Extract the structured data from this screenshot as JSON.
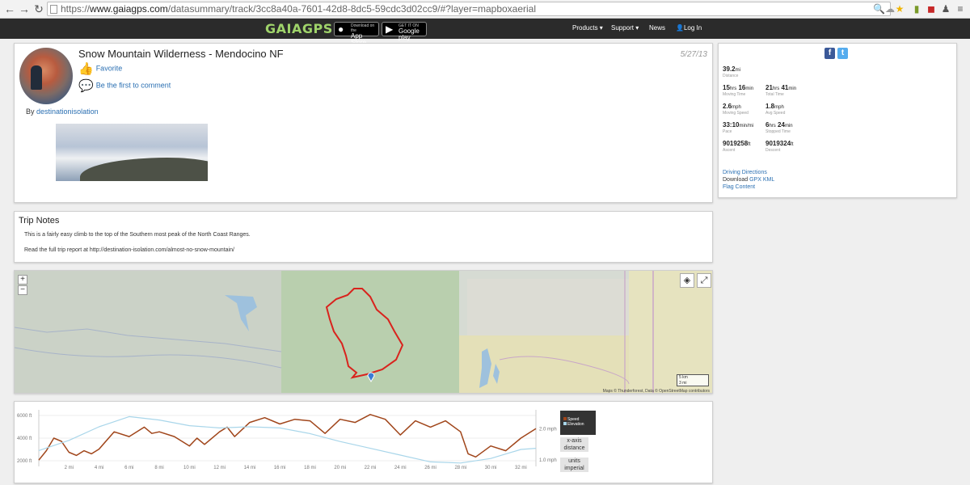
{
  "browser": {
    "url_prefix": "https://",
    "url_host": "www.gaiagps.com",
    "url_path": "/datasummary/track/3cc8a40a-7601-42d8-8dc5-59cdc3d02cc9/#?layer=mapboxaerial"
  },
  "header": {
    "logo": "GAIAGPS",
    "app_store": {
      "small": "Download on the",
      "label": "App Store"
    },
    "google_play": {
      "small": "GET IT ON",
      "label": "Google play"
    },
    "nav": [
      "Products ▾",
      "Support ▾",
      "News",
      "Log In"
    ]
  },
  "track": {
    "title": "Snow Mountain Wilderness - Mendocino NF",
    "date": "5/27/13",
    "favorite": "Favorite",
    "comment": "Be the first to comment",
    "by_prefix": "By",
    "author": "destinationisolation"
  },
  "stats": [
    {
      "value": "39.2",
      "unit": "mi",
      "label": "Distance"
    },
    {
      "value": "15",
      "unit": "hrs",
      "value2": "16",
      "unit2": "min",
      "label": "Moving Time"
    },
    {
      "value": "21",
      "unit": "hrs",
      "value2": "41",
      "unit2": "min",
      "label": "Total Time"
    },
    {
      "value": "2.6",
      "unit": "mph",
      "label": "Moving Speed"
    },
    {
      "value": "1.8",
      "unit": "mph",
      "label": "Avg Speed"
    },
    {
      "value": "33:10",
      "unit": "min/mi",
      "label": "Pace"
    },
    {
      "value": "6",
      "unit": "hrs",
      "value2": "24",
      "unit2": "min",
      "label": "Stopped Time"
    },
    {
      "value": "9019258",
      "unit": "ft",
      "label": "Ascent"
    },
    {
      "value": "9019324",
      "unit": "ft",
      "label": "Descent"
    }
  ],
  "links": {
    "driving": "Driving Directions",
    "download": "Download",
    "gpx": "GPX",
    "kml": "KML",
    "flag": "Flag Content"
  },
  "notes": {
    "title": "Trip Notes",
    "line1": "This is a fairly easy climb to the top of the Southern most peak of the North Coast Ranges.",
    "line2": "Read the full trip report at http://destination-isolation.com/almost-no-snow-mountain/"
  },
  "map": {
    "zoom_in": "+",
    "zoom_out": "−",
    "scale_km": "5 km",
    "scale_mi": "3 mi",
    "attribution": "Maps © Thunderforest, Data © OpenStreetMap contributors",
    "track_color": "#d9231d"
  },
  "chart": {
    "legend_speed": "Speed",
    "legend_elevation": "Elevation",
    "btn_x_axis_line1": "x-axis",
    "btn_x_axis_line2": "distance",
    "btn_units_line1": "units",
    "btn_units_line2": "imperial",
    "speed_color": "#a0451a",
    "elevation_color": "#a9d6ea"
  },
  "chart_data": {
    "type": "line",
    "xlabel": "",
    "ylabel": "",
    "x_ticks": [
      "2 mi",
      "4 mi",
      "6 mi",
      "8 mi",
      "10 mi",
      "12 mi",
      "14 mi",
      "16 mi",
      "18 mi",
      "20 mi",
      "22 mi",
      "24 mi",
      "26 mi",
      "28 mi",
      "30 mi",
      "32 mi"
    ],
    "y_left_ticks": [
      "2000 ft",
      "4000 ft",
      "6000 ft"
    ],
    "y_right_ticks": [
      "1.0 mph",
      "2.0 mph"
    ],
    "xlim": [
      0,
      33
    ],
    "series": [
      {
        "name": "Speed",
        "axis": "right",
        "x": [
          0,
          0.5,
          1,
          1.5,
          2,
          2.5,
          3,
          3.5,
          4,
          5,
          6,
          7,
          7.5,
          8,
          9,
          10,
          10.5,
          11,
          12,
          12.5,
          13,
          14,
          15,
          16,
          17,
          18,
          19,
          20,
          21,
          22,
          23,
          24,
          25,
          26,
          27,
          28,
          28.5,
          29,
          30,
          31,
          32,
          33
        ],
        "values": [
          1.0,
          1.3,
          1.7,
          1.6,
          1.25,
          1.15,
          1.3,
          1.2,
          1.35,
          1.9,
          1.75,
          2.05,
          1.85,
          1.9,
          1.75,
          1.45,
          1.7,
          1.5,
          1.9,
          2.05,
          1.75,
          2.2,
          2.35,
          2.15,
          2.3,
          2.25,
          1.85,
          2.3,
          2.2,
          2.45,
          2.3,
          1.8,
          2.25,
          2.05,
          2.25,
          1.9,
          1.2,
          1.1,
          1.45,
          1.3,
          1.7,
          2.0
        ]
      },
      {
        "name": "Elevation",
        "axis": "left",
        "x": [
          0,
          2,
          4,
          6,
          8,
          10,
          12,
          14,
          16,
          18,
          20,
          22,
          24,
          26,
          28,
          30,
          32,
          33
        ],
        "values": [
          2900,
          3800,
          5000,
          5900,
          5600,
          5100,
          4900,
          5000,
          4900,
          4400,
          3700,
          3100,
          2500,
          1900,
          1800,
          2200,
          3000,
          3100
        ]
      }
    ]
  }
}
